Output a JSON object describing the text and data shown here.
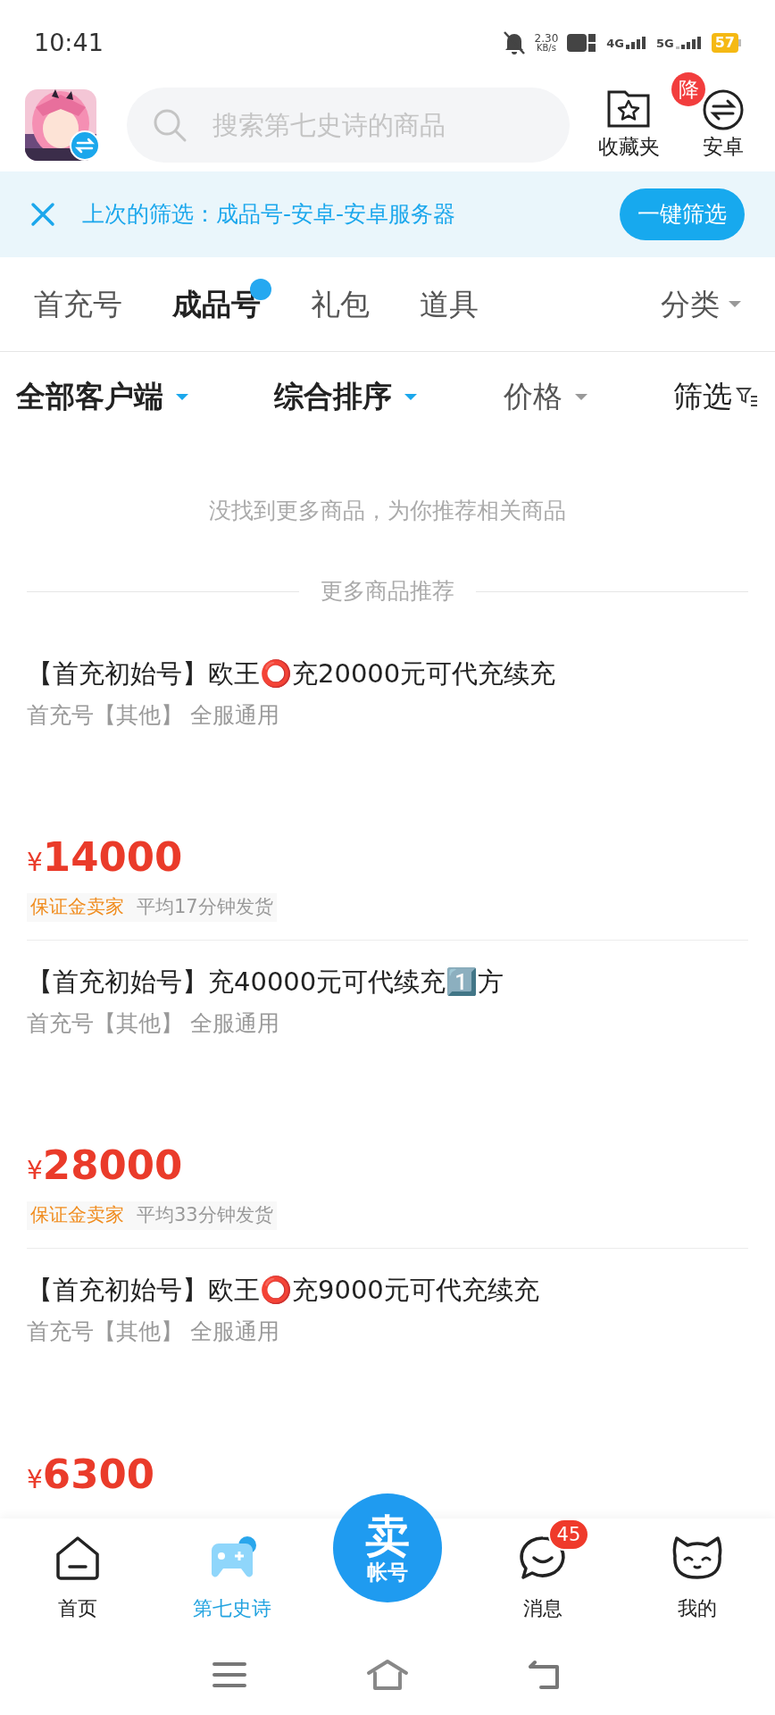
{
  "status_bar": {
    "time": "10:41",
    "speed": "2.30",
    "speed_unit": "KB/s",
    "network_1": "4G",
    "network_2": "5G",
    "battery": "57"
  },
  "header": {
    "search_placeholder": "搜索第七史诗的商品",
    "favorites": {
      "label": "收藏夹",
      "badge": "降"
    },
    "platform": {
      "label": "安卓"
    }
  },
  "last_filter": {
    "text": "上次的筛选：成品号-安卓-安卓服务器",
    "button": "一键筛选"
  },
  "tabs": [
    {
      "label": "首充号",
      "selected": false,
      "dot": false
    },
    {
      "label": "成品号",
      "selected": true,
      "dot": true
    },
    {
      "label": "礼包",
      "selected": false,
      "dot": false
    },
    {
      "label": "道具",
      "selected": false,
      "dot": false
    }
  ],
  "category": "分类",
  "sort_bar": [
    {
      "label": "全部客户端",
      "kind": "dropdown",
      "active": true
    },
    {
      "label": "综合排序",
      "kind": "dropdown",
      "active": true
    },
    {
      "label": "价格",
      "kind": "dropdown",
      "active": false
    },
    {
      "label": "筛选",
      "kind": "filter",
      "active": false
    }
  ],
  "empty_message": "没找到更多商品，为你推荐相关商品",
  "section_title": "更多商品推荐",
  "items": [
    {
      "title": "【首充初始号】欧王⭕充20000元可代充续充",
      "subtitle": "首充号【其他】 全服通用",
      "currency": "¥",
      "price": "14000",
      "tags": [
        "保证金卖家",
        "平均17分钟发货"
      ]
    },
    {
      "title": "【首充初始号】充40000元可代续充1️⃣方",
      "subtitle": "首充号【其他】 全服通用",
      "currency": "¥",
      "price": "28000",
      "tags": [
        "保证金卖家",
        "平均33分钟发货"
      ]
    },
    {
      "title": "【首充初始号】欧王⭕充9000元可代充续充",
      "subtitle": "首充号【其他】 全服通用",
      "currency": "¥",
      "price": "6300"
    }
  ],
  "bottom_nav": [
    {
      "label": "首页",
      "kind": "home",
      "selected": false
    },
    {
      "label": "第七史诗",
      "kind": "game",
      "selected": true
    },
    {
      "kind": "sell",
      "top": "卖",
      "bottom": "帐号"
    },
    {
      "label": "消息",
      "kind": "message",
      "selected": false,
      "badge": "45"
    },
    {
      "label": "我的",
      "kind": "profile",
      "selected": false
    }
  ]
}
